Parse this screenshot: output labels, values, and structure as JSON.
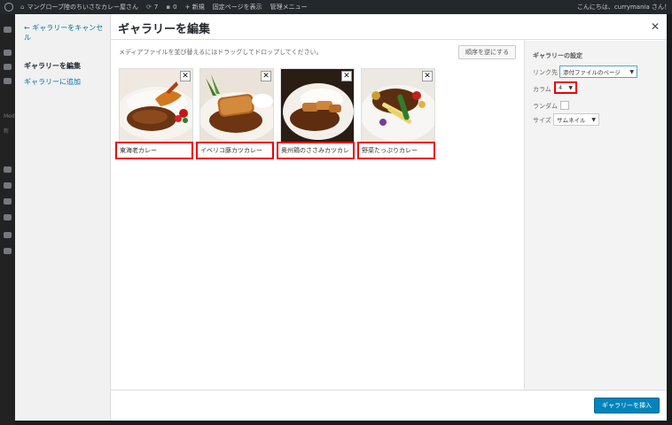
{
  "adminbar": {
    "site_name": "マングローブ陸のちいさなカレー屋さん",
    "updates_count": "7",
    "comments_count": "0",
    "new_label": "+ 新規",
    "view_page": "固定ページを表示",
    "admin_menu": "管理メニュー",
    "howdy": "こんにちは、currymania さん！"
  },
  "background_menu": {
    "item_1": "Media",
    "item_2": "新"
  },
  "modal": {
    "cancel_link": "← ギャラリーをキャンセル",
    "menu_edit": "ギャラリーを編集",
    "menu_add": "ギャラリーに追加",
    "title": "ギャラリーを編集",
    "close": "✕",
    "instructions": "メディアファイルを並び替えるにはドラッグしてドロップしてください。",
    "reverse_button": "順序を逆にする",
    "items": [
      {
        "caption": "東海老カレー",
        "image": "shrimp-curry"
      },
      {
        "caption": "イベリコ豚カツカレー",
        "image": "pork-cutlet-curry"
      },
      {
        "caption": "奥州鶏のささみカツカレ",
        "image": "chicken-cutlet-curry"
      },
      {
        "caption": "野菜たっぷりカレー",
        "image": "vegetable-curry"
      }
    ],
    "settings": {
      "heading": "ギャラリーの設定",
      "link_label": "リンク先",
      "link_value": "添付ファイルのページ",
      "columns_label": "カラム",
      "columns_value": "4",
      "random_label": "ランダム",
      "random_checked": false,
      "size_label": "サイズ",
      "size_value": "サムネイル"
    },
    "insert_button": "ギャラリーを挿入"
  }
}
